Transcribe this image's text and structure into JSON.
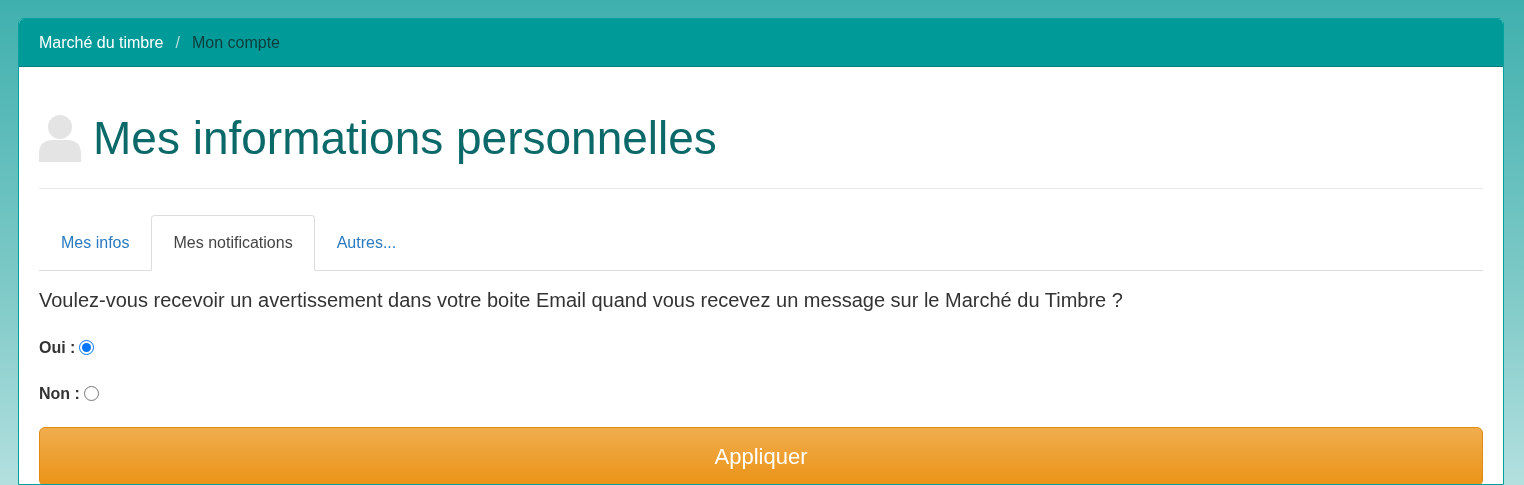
{
  "breadcrumb_separator": "/",
  "breadcrumb": [
    {
      "label": "Marché du timbre",
      "active": false
    },
    {
      "label": "Mon compte",
      "active": true
    }
  ],
  "heading": "Mes informations personnelles",
  "tabs": [
    {
      "label": "Mes infos",
      "selected": false
    },
    {
      "label": "Mes notifications",
      "selected": true
    },
    {
      "label": "Autres...",
      "selected": false
    }
  ],
  "question": "Voulez-vous recevoir un avertissement dans votre boite Email quand vous recevez un message sur le Marché du Timbre ?",
  "options": [
    {
      "label": "Oui :",
      "selected": true
    },
    {
      "label": "Non :",
      "selected": false
    }
  ],
  "submit": "Appliquer"
}
